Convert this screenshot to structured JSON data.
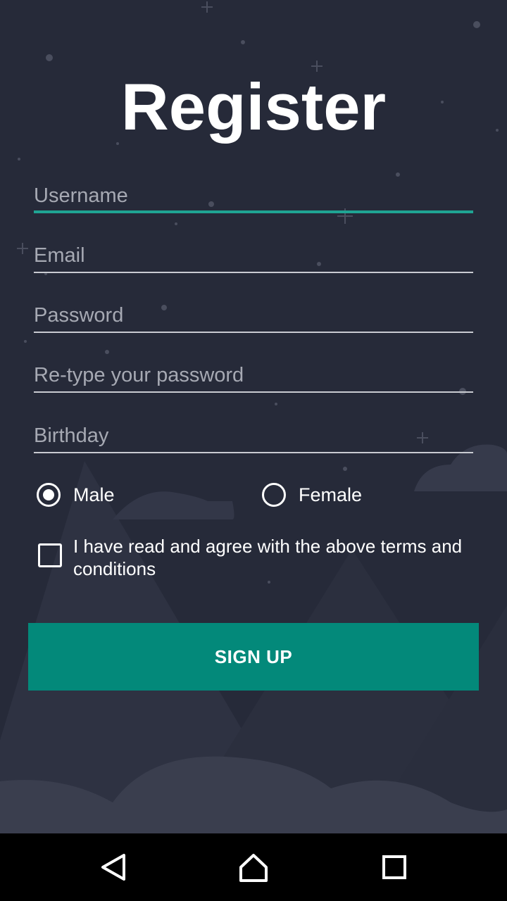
{
  "page": {
    "title": "Register"
  },
  "form": {
    "username": {
      "placeholder": "Username",
      "value": ""
    },
    "email": {
      "placeholder": "Email",
      "value": ""
    },
    "password": {
      "placeholder": "Password",
      "value": ""
    },
    "retype_password": {
      "placeholder": "Re-type your password",
      "value": ""
    },
    "birthday": {
      "placeholder": "Birthday",
      "value": ""
    }
  },
  "gender": {
    "options": [
      "Male",
      "Female"
    ],
    "selected": "Male"
  },
  "terms": {
    "label": "I have read and agree with the above terms and conditions",
    "checked": false
  },
  "signup_button": {
    "label": "SIGN UP"
  },
  "navbar": {
    "icons": [
      "back-icon",
      "home-icon",
      "recents-icon"
    ]
  },
  "colors": {
    "background": "#262a39",
    "accent": "#03897a",
    "focus_underline": "#1fa493",
    "navbar": "#000000"
  }
}
